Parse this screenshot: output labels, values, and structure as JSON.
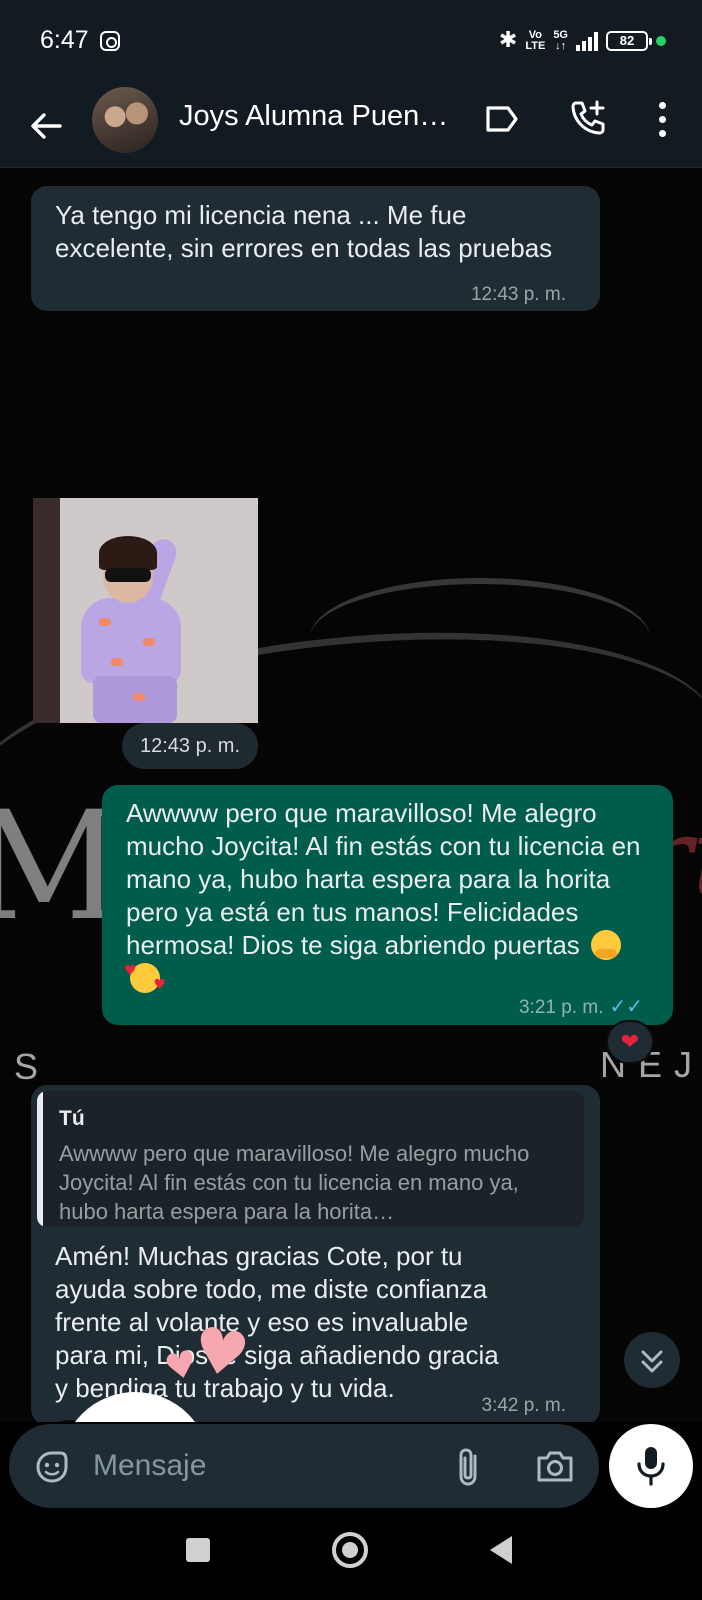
{
  "status_bar": {
    "time": "6:47",
    "network_volte_top": "Vo",
    "network_volte_bottom": "LTE",
    "network_type": "5G",
    "battery": "82"
  },
  "header": {
    "contact_name": "Joys Alumna Puen…"
  },
  "wallpaper": {
    "main": "ManelArt",
    "script": "Art",
    "sub_left": "S",
    "sub_right": "NEJ"
  },
  "messages": {
    "m1": {
      "text": "Ya tengo mi licencia nena ... Me fue excelente, sin errores en todas las pruebas",
      "time": "12:43 p. m."
    },
    "m2": {
      "time": "12:43 p. m."
    },
    "m3": {
      "text": "Awwww pero que maravilloso! Me alegro mucho Joycita! Al fin estás con tu licencia en mano ya, hubo harta espera para la horita pero ya está en tus manos! Felicidades hermosa! Dios te siga abriendo puertas",
      "time": "3:21 p. m.",
      "reaction": "❤"
    },
    "m4": {
      "quote_author": "Tú",
      "quote_text": "Awwww pero que maravilloso! Me alegro mucho Joycita! Al fin estás con tu licencia en mano ya, hubo harta espera para la horita…",
      "text": "Amén! Muchas gracias Cote, por tu ayuda sobre todo, me diste confianza frente al volante y eso es invaluable para mi, Dios te siga añadiendo gracia y bendiga tu trabajo y tu vida.",
      "time": "3:42 p. m.",
      "reaction": "❤"
    }
  },
  "composer": {
    "placeholder": "Mensaje"
  },
  "colors": {
    "incoming_bubble": "#202c33",
    "outgoing_bubble": "#005c4b",
    "header_bg": "#111b21",
    "read_check": "#53bdeb"
  },
  "icons": [
    "back-arrow-icon",
    "label-icon",
    "add-call-icon",
    "more-vert-icon",
    "sticker-icon",
    "attach-icon",
    "camera-icon",
    "mic-icon",
    "scroll-down-icon"
  ]
}
